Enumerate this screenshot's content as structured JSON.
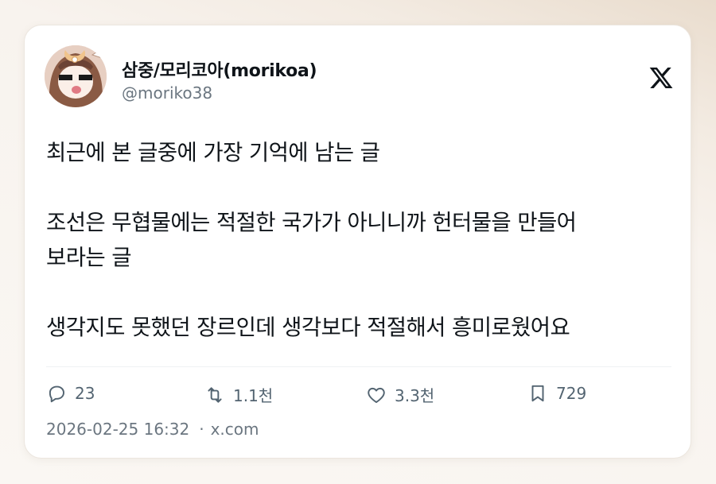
{
  "user": {
    "display_name": "삼중/모리코아(morikoa)",
    "handle": "@moriko38"
  },
  "post": {
    "lines": [
      "최근에 본 글중에 가장 기억에 남는 글",
      "",
      "조선은 무협물에는 적절한 국가가 아니니까 헌터물을 만들어",
      "보라는 글",
      "",
      "생각지도 못했던 장르인데 생각보다 적절해서 흥미로웠어요"
    ]
  },
  "actions": {
    "replies": "23",
    "reposts": "1.1천",
    "likes": "3.3천",
    "bookmarks": "729"
  },
  "meta": {
    "timestamp": "2026-02-25 16:32",
    "separator": "·",
    "source": "x.com"
  },
  "icons": {
    "brand": "x-logo-icon",
    "reply": "reply-icon",
    "repost": "repost-icon",
    "like": "heart-icon",
    "bookmark": "bookmark-icon"
  },
  "colors": {
    "text": "#0f1419",
    "secondary": "#536471"
  }
}
